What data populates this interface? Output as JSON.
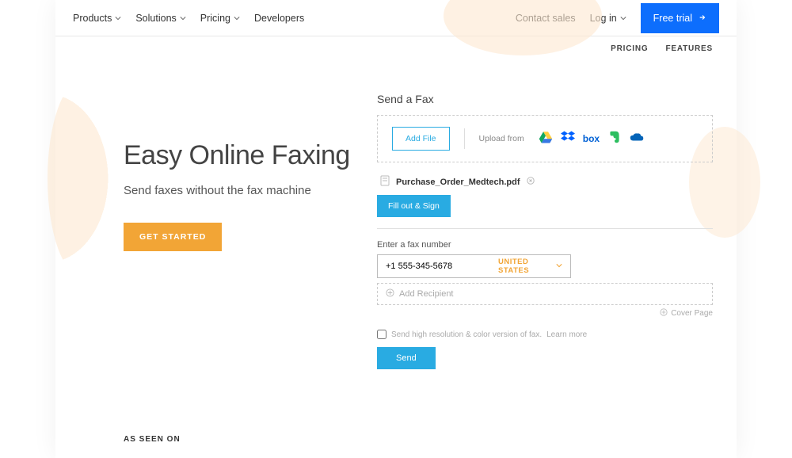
{
  "nav": {
    "products": "Products",
    "solutions": "Solutions",
    "pricing": "Pricing",
    "developers": "Developers",
    "contact_sales": "Contact sales",
    "login": "Log in",
    "free_trial": "Free trial"
  },
  "subnav": {
    "pricing": "PRICING",
    "features": "FEATURES"
  },
  "hero": {
    "headline": "Easy Online Faxing",
    "subhead": "Send faxes without the fax machine",
    "cta": "GET STARTED"
  },
  "fax": {
    "panel_title": "Send a Fax",
    "add_file": "Add File",
    "upload_from": "Upload from",
    "file_name": "Purchase_Order_Medtech.pdf",
    "fill_sign": "Fill out & Sign",
    "enter_number_label": "Enter a fax number",
    "fax_number": "+1 555-345-5678",
    "country": "UNITED STATES",
    "add_recipient": "Add Recipient",
    "cover_page": "Cover Page",
    "hires_label": "Send high resolution & color version of fax.",
    "learn_more": "Learn more",
    "send": "Send"
  },
  "providers": [
    "google-drive",
    "dropbox",
    "box",
    "evernote",
    "onedrive"
  ],
  "footer": {
    "as_seen_on": "AS SEEN ON"
  }
}
